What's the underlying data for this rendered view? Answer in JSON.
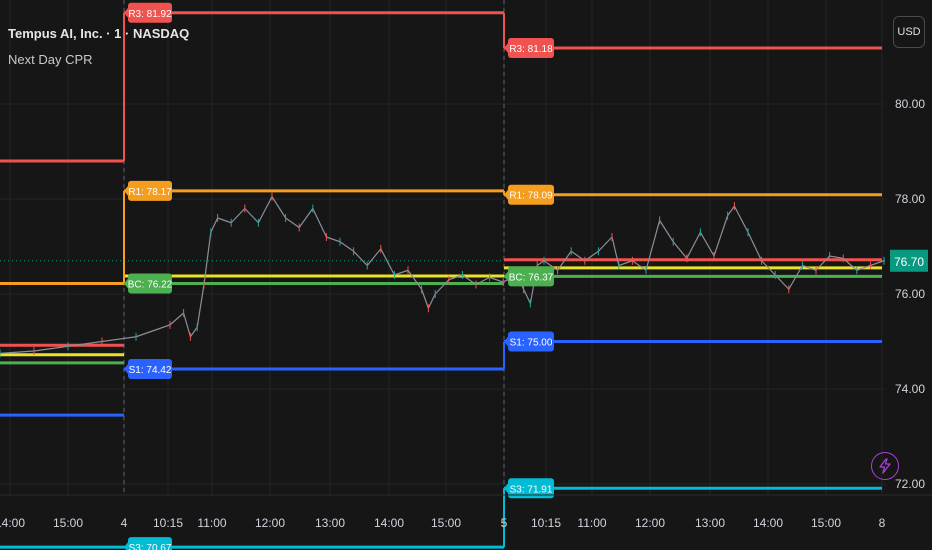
{
  "header": {
    "symbol_title": "Tempus AI, Inc. · 1 · NASDAQ",
    "indicator_name": "Next Day CPR"
  },
  "currency_button": {
    "label": "USD"
  },
  "lightning_icon": {
    "name": "lightning-icon"
  },
  "colors": {
    "background": "#161616",
    "grid": "#242424",
    "r3": "#f0524f",
    "r1": "#f59d1e",
    "bc": "#4caf50",
    "pivot_yellow": "#e9e327",
    "s1": "#2962ff",
    "s3": "#00bcd4",
    "price_label_bg": "#089981",
    "bolt": "#a742d6"
  },
  "chart_data": {
    "type": "line",
    "title": "",
    "ylim": [
      69.5,
      82.3
    ],
    "y_ticks": [
      "80.00",
      "78.00",
      "76.00",
      "74.00",
      "72.00"
    ],
    "y_tick_values": [
      80,
      78,
      76,
      74,
      72
    ],
    "x_ticks": [
      "14:00",
      "15:00",
      "4",
      "10:15",
      "11:00",
      "12:00",
      "13:00",
      "14:00",
      "15:00",
      "5",
      "10:15",
      "11:00",
      "12:00",
      "13:00",
      "14:00",
      "15:00",
      "8"
    ],
    "session_dividers": [
      "4",
      "5"
    ],
    "last_price": {
      "label": "76.70",
      "value": 76.7
    },
    "levels": [
      {
        "name": "R3",
        "day": "previous",
        "value": 78.8,
        "color_key": "r3"
      },
      {
        "name": "R1",
        "day": "previous",
        "value": 76.22,
        "color_key": "r1"
      },
      {
        "name": "S1",
        "day": "previous",
        "value": 74.92,
        "color_key": "r3"
      },
      {
        "name": "S1b",
        "day": "previous",
        "value": 74.72,
        "color_key": "pivot_yellow"
      },
      {
        "name": "S1c",
        "day": "previous",
        "value": 74.55,
        "color_key": "bc"
      },
      {
        "name": "S2",
        "day": "previous",
        "value": 73.45,
        "color_key": "s1"
      },
      {
        "name": "S3",
        "day": "previous",
        "value": 70.67,
        "color_key": "s3"
      },
      {
        "name": "R3",
        "day": "4",
        "value": 81.92,
        "color_key": "r3",
        "label": "R3: 81.92"
      },
      {
        "name": "R1",
        "day": "4",
        "value": 78.17,
        "color_key": "r1",
        "label": "R1: 78.17"
      },
      {
        "name": "BC",
        "day": "4",
        "value": 76.22,
        "color_key": "bc",
        "label": "BC: 76.22"
      },
      {
        "name": "TC",
        "day": "4",
        "value": 76.38,
        "color_key": "pivot_yellow"
      },
      {
        "name": "S1",
        "day": "4",
        "value": 74.42,
        "color_key": "s1",
        "label": "S1: 74.42"
      },
      {
        "name": "S3",
        "day": "4",
        "value": 70.67,
        "color_key": "s3",
        "label": "S3: 70.67"
      },
      {
        "name": "R3",
        "day": "5",
        "value": 81.18,
        "color_key": "r3",
        "label": "R3: 81.18"
      },
      {
        "name": "R1",
        "day": "5",
        "value": 78.09,
        "color_key": "r1",
        "label": "R1: 78.09"
      },
      {
        "name": "TC",
        "day": "5",
        "value": 76.72,
        "color_key": "r3"
      },
      {
        "name": "P",
        "day": "5",
        "value": 76.55,
        "color_key": "pivot_yellow"
      },
      {
        "name": "BC",
        "day": "5",
        "value": 76.37,
        "color_key": "bc",
        "label": "BC: 76.37"
      },
      {
        "name": "S1",
        "day": "5",
        "value": 75.0,
        "color_key": "s1",
        "label": "S1: 75.00"
      },
      {
        "name": "S3",
        "day": "5",
        "value": 71.91,
        "color_key": "s3",
        "label": "S3: 71.91"
      }
    ],
    "price_series": [
      {
        "t": 0.0,
        "v": 74.75
      },
      {
        "t": 0.05,
        "v": 74.8
      },
      {
        "t": 0.1,
        "v": 74.9
      },
      {
        "t": 0.15,
        "v": 75.0
      },
      {
        "t": 0.2,
        "v": 75.1
      },
      {
        "t": 0.25,
        "v": 75.35
      },
      {
        "t": 0.27,
        "v": 75.6
      },
      {
        "t": 0.28,
        "v": 75.1
      },
      {
        "t": 0.29,
        "v": 75.3
      },
      {
        "t": 0.3,
        "v": 76.2
      },
      {
        "t": 0.31,
        "v": 77.3
      },
      {
        "t": 0.32,
        "v": 77.6
      },
      {
        "t": 0.34,
        "v": 77.5
      },
      {
        "t": 0.36,
        "v": 77.8
      },
      {
        "t": 0.38,
        "v": 77.5
      },
      {
        "t": 0.4,
        "v": 78.05
      },
      {
        "t": 0.42,
        "v": 77.6
      },
      {
        "t": 0.44,
        "v": 77.4
      },
      {
        "t": 0.46,
        "v": 77.8
      },
      {
        "t": 0.48,
        "v": 77.2
      },
      {
        "t": 0.5,
        "v": 77.1
      },
      {
        "t": 0.52,
        "v": 76.9
      },
      {
        "t": 0.54,
        "v": 76.6
      },
      {
        "t": 0.56,
        "v": 76.95
      },
      {
        "t": 0.58,
        "v": 76.4
      },
      {
        "t": 0.6,
        "v": 76.5
      },
      {
        "t": 0.62,
        "v": 76.1
      },
      {
        "t": 0.63,
        "v": 75.7
      },
      {
        "t": 0.64,
        "v": 76.0
      },
      {
        "t": 0.66,
        "v": 76.3
      },
      {
        "t": 0.68,
        "v": 76.4
      },
      {
        "t": 0.7,
        "v": 76.2
      },
      {
        "t": 0.72,
        "v": 76.35
      },
      {
        "t": 0.74,
        "v": 76.25
      },
      {
        "t": 0.76,
        "v": 76.4
      },
      {
        "t": 0.77,
        "v": 76.1
      },
      {
        "t": 0.78,
        "v": 75.8
      },
      {
        "t": 0.79,
        "v": 76.6
      },
      {
        "t": 0.8,
        "v": 76.7
      },
      {
        "t": 0.82,
        "v": 76.5
      },
      {
        "t": 0.84,
        "v": 76.9
      },
      {
        "t": 0.86,
        "v": 76.7
      },
      {
        "t": 0.88,
        "v": 76.9
      },
      {
        "t": 0.9,
        "v": 77.2
      },
      {
        "t": 0.91,
        "v": 76.6
      },
      {
        "t": 0.93,
        "v": 76.7
      },
      {
        "t": 0.95,
        "v": 76.5
      },
      {
        "t": 0.97,
        "v": 77.55
      },
      {
        "t": 0.99,
        "v": 77.1
      },
      {
        "t": 1.01,
        "v": 76.75
      },
      {
        "t": 1.03,
        "v": 77.3
      },
      {
        "t": 1.05,
        "v": 76.8
      },
      {
        "t": 1.07,
        "v": 77.65
      },
      {
        "t": 1.08,
        "v": 77.85
      },
      {
        "t": 1.1,
        "v": 77.3
      },
      {
        "t": 1.12,
        "v": 76.7
      },
      {
        "t": 1.14,
        "v": 76.4
      },
      {
        "t": 1.16,
        "v": 76.1
      },
      {
        "t": 1.18,
        "v": 76.6
      },
      {
        "t": 1.2,
        "v": 76.5
      },
      {
        "t": 1.22,
        "v": 76.8
      },
      {
        "t": 1.24,
        "v": 76.75
      },
      {
        "t": 1.26,
        "v": 76.5
      },
      {
        "t": 1.28,
        "v": 76.6
      },
      {
        "t": 1.3,
        "v": 76.7
      }
    ]
  }
}
